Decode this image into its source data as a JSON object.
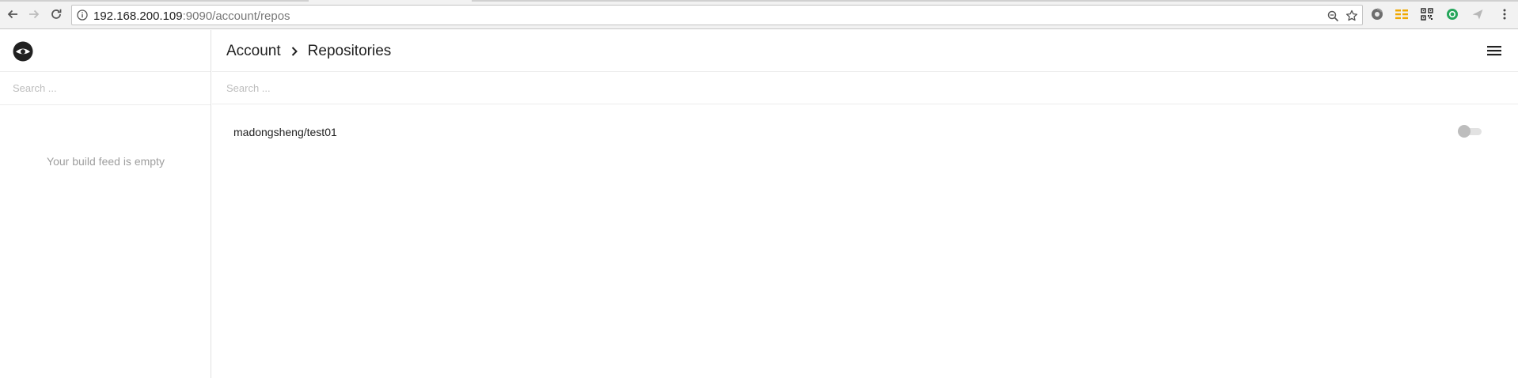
{
  "browser": {
    "url_host": "192.168.200.109",
    "url_rest": ":9090/account/repos"
  },
  "sidebar": {
    "search_placeholder": "Search ...",
    "empty_text": "Your build feed is empty"
  },
  "header": {
    "breadcrumb": [
      "Account",
      "Repositories"
    ]
  },
  "main": {
    "search_placeholder": "Search ...",
    "repos": [
      {
        "name": "madongsheng/test01",
        "active": false
      }
    ]
  },
  "colors": {
    "ext_grid": "#f0a800",
    "ext_green": "#26a65b",
    "toggle_off": "#bdbdbd"
  }
}
